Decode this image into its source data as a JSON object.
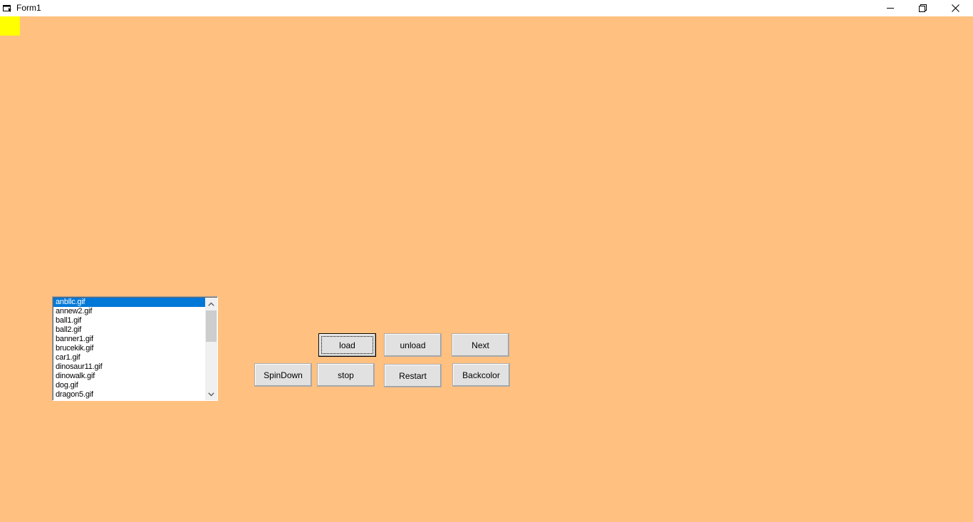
{
  "window": {
    "title": "Form1",
    "icon": "form-icon",
    "controls": {
      "minimize_icon": "minimize-icon",
      "restore_icon": "restore-icon",
      "close_icon": "close-icon"
    }
  },
  "form": {
    "background_color": "#ffc080",
    "indicator_color": "#ffff00"
  },
  "file_list": {
    "selected_index": 0,
    "items": [
      "anbllc.gif",
      "annew2.gif",
      "ball1.gif",
      "ball2.gif",
      "banner1.gif",
      "brucekik.gif",
      "car1.gif",
      "dinosaur11.gif",
      "dinowalk.gif",
      "dog.gif",
      "dragon5.gif"
    ],
    "scroll_up_icon": "chevron-up-icon",
    "scroll_down_icon": "chevron-down-icon"
  },
  "buttons": {
    "load": "load",
    "unload": "unload",
    "next": "Next",
    "spindown": "SpinDown",
    "stop": "stop",
    "restart": "Restart",
    "backcolor": "Backcolor"
  }
}
